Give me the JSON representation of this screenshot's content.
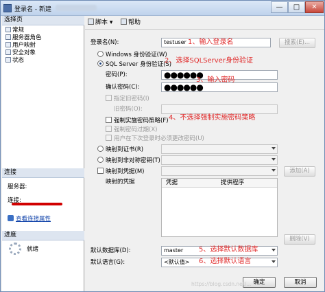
{
  "window": {
    "title": "登录名 - 新建",
    "min_glyph": "—",
    "max_glyph": "□",
    "close_glyph": "✕"
  },
  "left_panel": {
    "pages_header": "选择页",
    "pages": [
      "常规",
      "服务器角色",
      "用户映射",
      "安全对象",
      "状态"
    ],
    "connection_header": "连接",
    "server_label": "服务器:",
    "connection_label": "连接:",
    "view_connection_link": "查看连接属性",
    "progress_header": "进度",
    "progress_status": "就绪"
  },
  "toolbar": {
    "script_label": "脚本",
    "help_label": "帮助"
  },
  "form": {
    "login_name_label": "登录名(N):",
    "login_name_value": "testuser",
    "search_button": "搜索(E)...",
    "windows_auth_label": "Windows 身份验证(W)",
    "sql_auth_label": "SQL Server 身份验证(S)",
    "password_label": "密码(P):",
    "password_value": "●●●●●●",
    "confirm_password_label": "确认密码(C):",
    "confirm_password_value": "●●●●●●",
    "specify_old_password_label": "指定旧密码(I)",
    "old_password_label": "旧密码(O):",
    "enforce_policy_label": "强制实施密码策略(F)",
    "enforce_expiration_label": "强制密码过期(X)",
    "must_change_label": "用户在下次登录时必须更改密码(U)",
    "map_cert_label": "映射到证书(R)",
    "map_asym_key_label": "映射到非对称密钥(T)",
    "map_credential_label": "映射到凭据(M)",
    "add_button": "添加(A)",
    "mapped_credentials_label": "映射的凭据",
    "grid_col_credential": "凭据",
    "grid_col_provider": "提供程序",
    "remove_button": "删除(V)",
    "default_db_label": "默认数据库(D):",
    "default_db_value": "master",
    "default_lang_label": "默认语言(G):",
    "default_lang_value": "<默认值>"
  },
  "annotations": {
    "a1": "1、输入登录名",
    "a2": "2、选择SQLServer身份验证",
    "a3": "3、输入密码",
    "a4": "4、不选择强制实施密码策略",
    "a5": "5、选择默认数据库",
    "a6": "6、选择默认语言"
  },
  "footer": {
    "ok_button": "确定",
    "cancel_button": "取消",
    "watermark": "https://blog.csdn.net/..."
  },
  "colors": {
    "annotation": "#e12c2c",
    "title_gradient_top": "#dbe8f7",
    "connection_redaction": "#d10000"
  }
}
